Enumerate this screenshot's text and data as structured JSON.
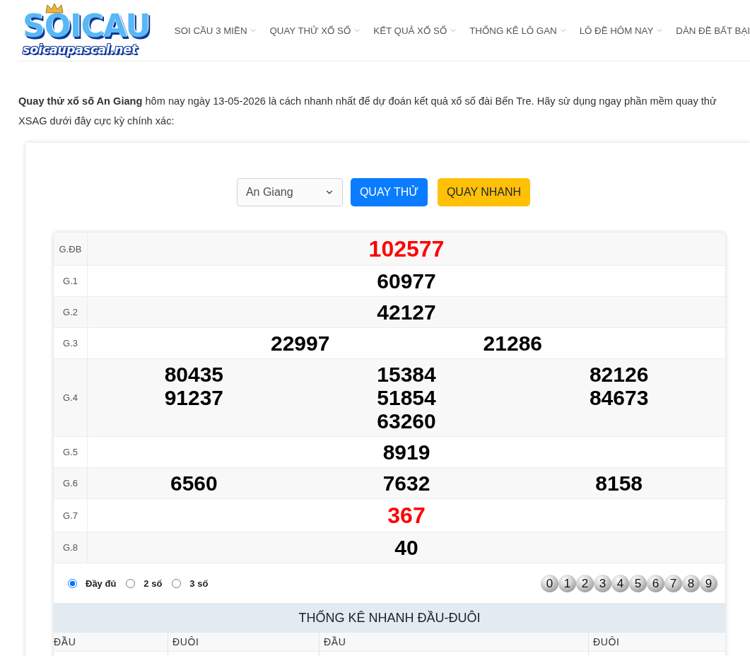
{
  "header": {
    "logo": {
      "title": "SOICAU",
      "subtitle": "soicaupascal.net"
    },
    "nav": [
      {
        "label": "SOI CẦU 3 MIỀN",
        "dropdown": true
      },
      {
        "label": "QUAY THỬ XỔ SỐ",
        "dropdown": true
      },
      {
        "label": "KẾT QUẢ XỔ SỐ",
        "dropdown": true
      },
      {
        "label": "THỐNG KÊ LÔ GAN",
        "dropdown": true
      },
      {
        "label": "LÔ ĐỀ HÔM NAY",
        "dropdown": true
      },
      {
        "label": "DÀN ĐỀ BẤT BẠI",
        "dropdown": false
      }
    ]
  },
  "intro": "**Quay thử xổ số An Giang** hôm nay ngày 13-05-2026 là cách nhanh nhất để dự đoán kết quả xổ số đài Bến Tre. Hãy sử dụng ngay phần mềm quay thử XSAG dưới đây cực kỳ chính xác:",
  "controls": {
    "province": {
      "value": "An Giang"
    },
    "buttons": [
      {
        "label": "QUAY THỬ",
        "kind": "primary"
      },
      {
        "label": "QUAY NHANH",
        "kind": "warning"
      }
    ]
  },
  "results": [
    {
      "prize": "G.ĐB",
      "numbers": [
        "102577"
      ],
      "highlight": true
    },
    {
      "prize": "G.1",
      "numbers": [
        "60977"
      ],
      "highlight": false
    },
    {
      "prize": "G.2",
      "numbers": [
        "42127"
      ],
      "highlight": false
    },
    {
      "prize": "G.3",
      "numbers": [
        "22997",
        "21286"
      ],
      "highlight": false
    },
    {
      "prize": "G.4",
      "numbers": [
        "80435",
        "15384",
        "82126",
        "91237",
        "51854",
        "84673",
        "63260"
      ],
      "highlight": false
    },
    {
      "prize": "G.5",
      "numbers": [
        "8919"
      ],
      "highlight": false
    },
    {
      "prize": "G.6",
      "numbers": [
        "6560",
        "7632",
        "8158"
      ],
      "highlight": false
    },
    {
      "prize": "G.7",
      "numbers": [
        "367"
      ],
      "highlight": true
    },
    {
      "prize": "G.8",
      "numbers": [
        "40"
      ],
      "highlight": false
    }
  ],
  "display_options": [
    {
      "label": "Đầy đủ",
      "selected": true
    },
    {
      "label": "2 số",
      "selected": false
    },
    {
      "label": "3 số",
      "selected": false
    }
  ],
  "digit_balls": [
    "0",
    "1",
    "2",
    "3",
    "4",
    "5",
    "6",
    "7",
    "8",
    "9"
  ],
  "stats": {
    "title": "THỐNG KÊ NHANH ĐẦU-ĐUÔI",
    "columns": [
      "ĐẦU",
      "ĐUÔI",
      "ĐẦU",
      "ĐUÔI"
    ]
  }
}
